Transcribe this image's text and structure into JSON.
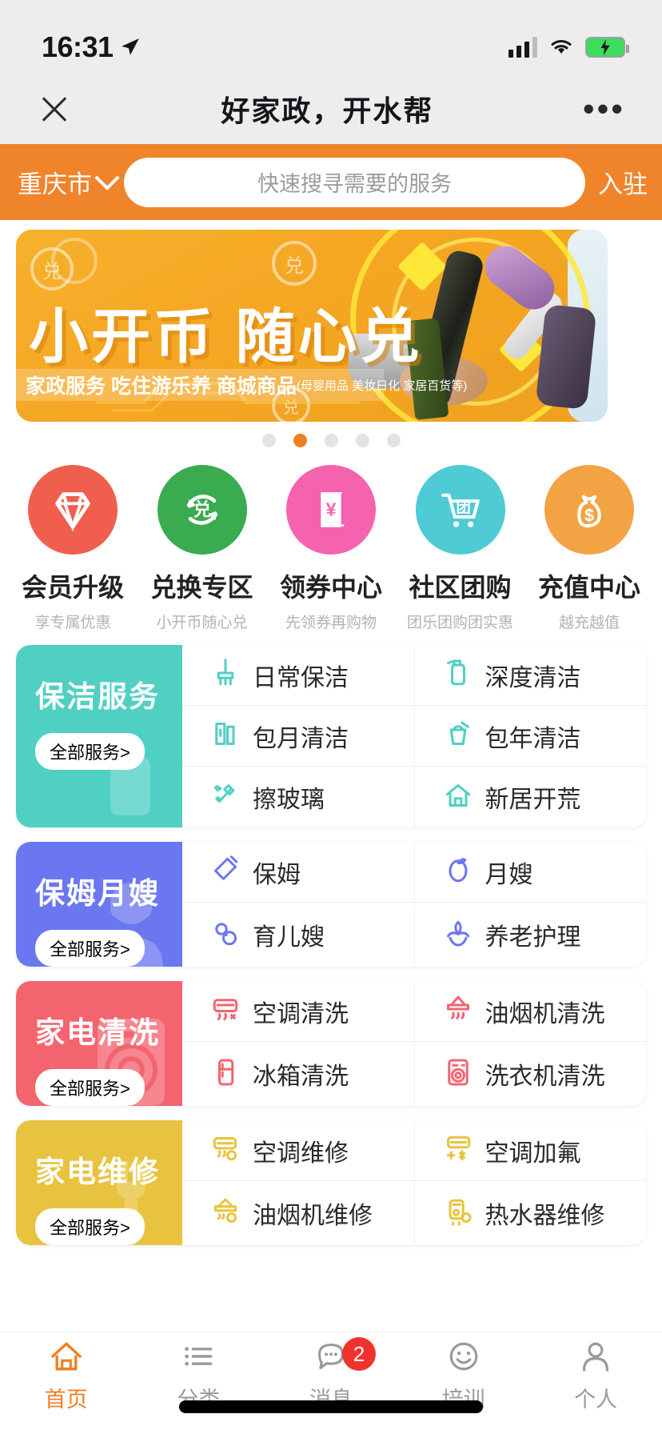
{
  "status_bar": {
    "time": "16:31",
    "location_icon": "location-arrow-icon",
    "signal_icon": "cellular-signal-icon",
    "wifi_icon": "wifi-icon",
    "battery_icon": "battery-charging-icon"
  },
  "nav": {
    "close_icon": "close-icon",
    "title": "好家政，开水帮",
    "more_icon": "more-dots-icon"
  },
  "search": {
    "city": "重庆市",
    "city_chevron_icon": "chevron-down-icon",
    "placeholder": "快速搜寻需要的服务",
    "value": "",
    "enter_label": "入驻"
  },
  "banner": {
    "title": "小开币 随心兑",
    "subtitle_main": "家政服务 吃住游乐养 商城商品",
    "subtitle_note": "(母婴用品 美妆日化 家居百货等)",
    "dots_total": 5,
    "active_dot": 2,
    "active_color": "#ee8123",
    "inactive_color": "#e3e3e3"
  },
  "quick_actions": [
    {
      "label": "会员升级",
      "sub": "享专属优惠",
      "icon": "diamond-icon",
      "color": "#f05f4e"
    },
    {
      "label": "兑换专区",
      "sub": "小开币随心兑",
      "icon": "exchange-icon",
      "color": "#3aab4f"
    },
    {
      "label": "领券中心",
      "sub": "先领券再购物",
      "icon": "coupon-icon",
      "color": "#f562ae"
    },
    {
      "label": "社区团购",
      "sub": "团乐团购团实惠",
      "icon": "cart-icon",
      "color": "#4ecbd4"
    },
    {
      "label": "充值中心",
      "sub": "越充越值",
      "icon": "money-bag-icon",
      "color": "#f2a344"
    }
  ],
  "categories": [
    {
      "title": "保洁服务",
      "all_label": "全部服务>",
      "color": "#4fd0c3",
      "ghost_icon": "spray-bottle-icon",
      "items": [
        {
          "name": "日常保洁",
          "icon": "mop-icon"
        },
        {
          "name": "深度清洁",
          "icon": "spray-bottle-icon"
        },
        {
          "name": "包月清洁",
          "icon": "calendar-month-icon"
        },
        {
          "name": "包年清洁",
          "icon": "bucket-icon"
        },
        {
          "name": "擦玻璃",
          "icon": "squeegee-icon"
        },
        {
          "name": "新居开荒",
          "icon": "house-icon"
        }
      ]
    },
    {
      "title": "保姆月嫂",
      "all_label": "全部服务>",
      "color": "#6b77f0",
      "ghost_icon": "nanny-avatar-icon",
      "items": [
        {
          "name": "保姆",
          "icon": "baby-bottle-icon"
        },
        {
          "name": "月嫂",
          "icon": "baby-icon"
        },
        {
          "name": "育儿嫂",
          "icon": "pacifier-icon"
        },
        {
          "name": "养老护理",
          "icon": "hands-plant-icon"
        }
      ]
    },
    {
      "title": "家电清洗",
      "all_label": "全部服务>",
      "color": "#f4646f",
      "ghost_icon": "washing-machine-icon",
      "items": [
        {
          "name": "空调清洗",
          "icon": "air-conditioner-icon"
        },
        {
          "name": "油烟机清洗",
          "icon": "range-hood-icon"
        },
        {
          "name": "冰箱清洗",
          "icon": "refrigerator-icon"
        },
        {
          "name": "洗衣机清洗",
          "icon": "washing-machine-icon"
        }
      ]
    },
    {
      "title": "家电维修",
      "all_label": "全部服务>",
      "color": "#e8c33f",
      "ghost_icon": "wrench-icon",
      "items": [
        {
          "name": "空调维修",
          "icon": "air-conditioner-gear-icon"
        },
        {
          "name": "空调加氟",
          "icon": "air-conditioner-freon-icon"
        },
        {
          "name": "油烟机维修",
          "icon": "range-hood-gear-icon"
        },
        {
          "name": "热水器维修",
          "icon": "water-heater-gear-icon"
        }
      ]
    }
  ],
  "tabbar": [
    {
      "label": "首页",
      "icon": "home-icon",
      "active": true,
      "badge": ""
    },
    {
      "label": "分类",
      "icon": "list-icon",
      "active": false,
      "badge": ""
    },
    {
      "label": "消息",
      "icon": "chat-icon",
      "active": false,
      "badge": "2"
    },
    {
      "label": "培训",
      "icon": "smiley-icon",
      "active": false,
      "badge": ""
    },
    {
      "label": "个人",
      "icon": "person-icon",
      "active": false,
      "badge": ""
    }
  ]
}
